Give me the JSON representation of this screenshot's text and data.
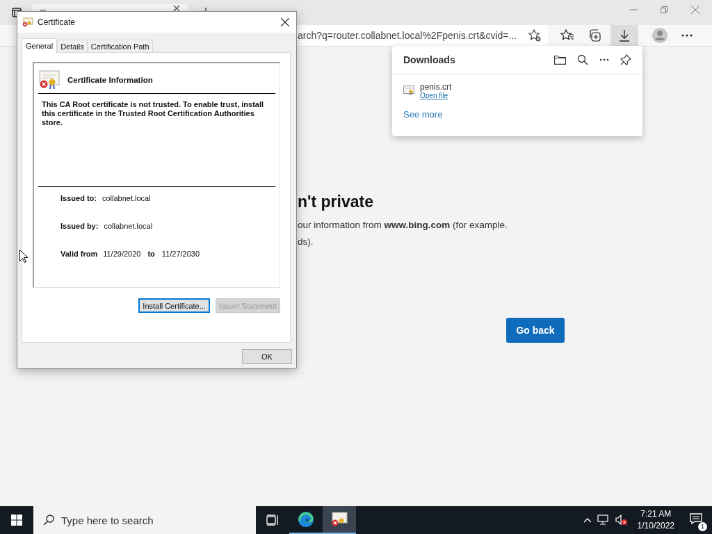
{
  "browser": {
    "address": "arch?q=router.collabnet.local%2Fpenis.crt&cvid=...",
    "page": {
      "heading": "n't private",
      "lines": [
        "our information from **www.bing.com** (for example.",
        "ds)."
      ],
      "button": "Go back"
    }
  },
  "downloads": {
    "title": "Downloads",
    "items": [
      {
        "name": "penis.crt",
        "action": "Open file"
      }
    ],
    "see_more": "See more"
  },
  "dialog": {
    "title": "Certificate",
    "tabs": [
      {
        "label": "General",
        "selected": true
      },
      {
        "label": "Details",
        "selected": false
      },
      {
        "label": "Certification Path",
        "selected": false
      }
    ],
    "heading": "Certificate Information",
    "message": "This CA Root certificate is not trusted. To enable trust, install this certificate in the Trusted Root Certification Authorities store.",
    "fields": [
      {
        "label": "Issued to:",
        "value": "collabnet.local"
      },
      {
        "label": "Issued by:",
        "value": "collabnet.local"
      }
    ],
    "validity": {
      "label": "Valid from",
      "from": "11/29/2020",
      "to_label": "to",
      "to": "11/27/2030"
    },
    "buttons": [
      {
        "label": "Install Certificate...",
        "disabled": false,
        "focused": true
      },
      {
        "label": "Issuer Statement",
        "disabled": true,
        "focused": false
      }
    ],
    "ok": "OK"
  },
  "taskbar": {
    "search_placeholder": "Type here to search",
    "time": "7:21 AM",
    "date": "1/10/2022",
    "notification_count": "1"
  }
}
